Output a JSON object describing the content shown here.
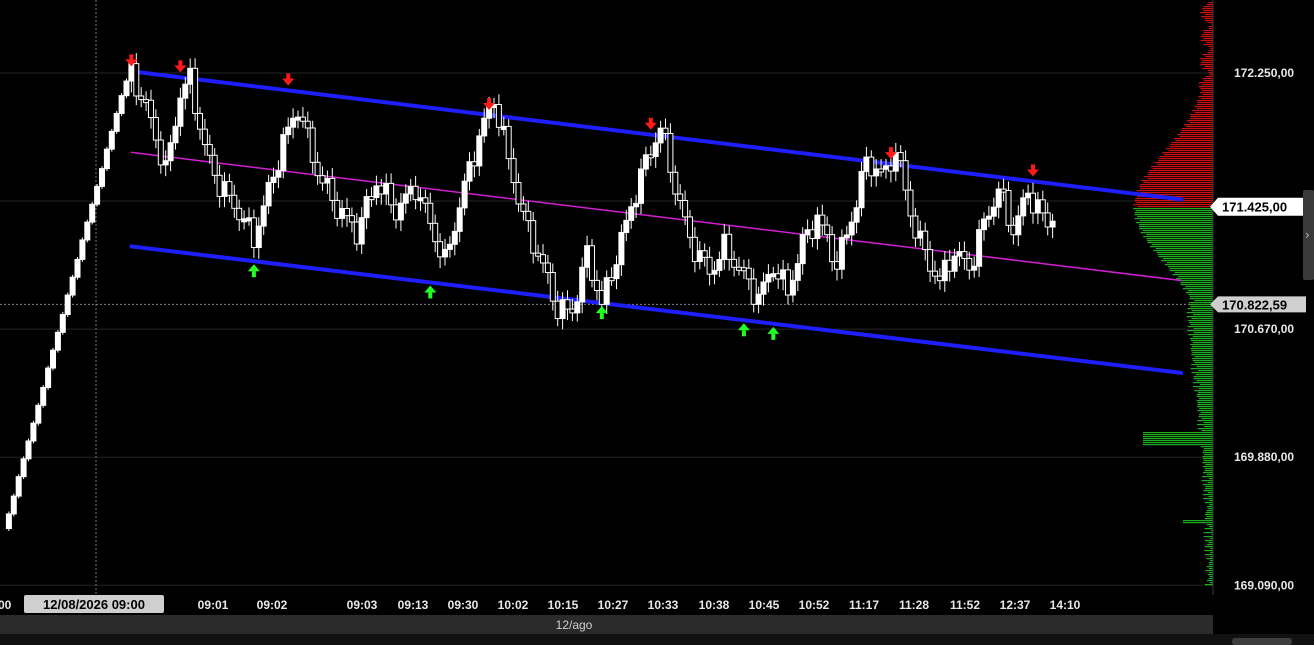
{
  "chart_data": {
    "type": "candlestick",
    "instrument_date": "12/08/2026 09:00",
    "session_label": "12/ago",
    "left_edge_label": "00",
    "x_tick_labels": [
      "09:01",
      "09:02",
      "09:03",
      "09:13",
      "09:30",
      "10:02",
      "10:15",
      "10:27",
      "10:33",
      "10:38",
      "10:45",
      "10:52",
      "11:17",
      "11:28",
      "11:52",
      "12:37",
      "14:10"
    ],
    "y_tick_labels": [
      {
        "label": "172.250,00",
        "value": 172250
      },
      {
        "label": "170.670,00",
        "value": 170670
      },
      {
        "label": "169.880,00",
        "value": 169880
      },
      {
        "label": "169.090,00",
        "value": 169090
      }
    ],
    "hidden_tick_value": 171460,
    "ylim": [
      169030,
      172700
    ],
    "last_price": {
      "label": "171.425,00",
      "value": 171425
    },
    "reference_price": {
      "label": "170.822,59",
      "value": 170822.59
    },
    "price_path": [
      [
        0,
        169440
      ],
      [
        0.5,
        169530
      ],
      [
        1,
        169640
      ],
      [
        1.5,
        169760
      ],
      [
        2,
        169870
      ],
      [
        2.5,
        169980
      ],
      [
        3,
        170090
      ],
      [
        3.5,
        170200
      ],
      [
        4,
        170310
      ],
      [
        4.5,
        170430
      ],
      [
        5,
        170540
      ],
      [
        5.5,
        170650
      ],
      [
        6,
        170760
      ],
      [
        6.5,
        170880
      ],
      [
        7,
        170990
      ],
      [
        7.5,
        171100
      ],
      [
        8,
        171220
      ],
      [
        8.5,
        171330
      ],
      [
        9,
        171440
      ],
      [
        9.5,
        171550
      ],
      [
        10,
        171660
      ],
      [
        10.5,
        171780
      ],
      [
        11,
        171890
      ],
      [
        11.5,
        172000
      ],
      [
        12,
        172110
      ],
      [
        12.5,
        172200
      ],
      [
        13,
        172250
      ],
      [
        15,
        171960
      ],
      [
        16.5,
        171640
      ],
      [
        18,
        172120
      ],
      [
        19,
        172210
      ],
      [
        20.5,
        171780
      ],
      [
        22,
        171560
      ],
      [
        24,
        171390
      ],
      [
        25.5,
        171230
      ],
      [
        27,
        171520
      ],
      [
        28.5,
        171820
      ],
      [
        30,
        172040
      ],
      [
        32,
        171640
      ],
      [
        34,
        171420
      ],
      [
        36,
        171270
      ],
      [
        38,
        171580
      ],
      [
        40,
        171400
      ],
      [
        42,
        171550
      ],
      [
        43.5,
        171320
      ],
      [
        45,
        171080
      ],
      [
        47,
        171550
      ],
      [
        48.5,
        171860
      ],
      [
        50,
        172090
      ],
      [
        51.5,
        171720
      ],
      [
        53,
        171360
      ],
      [
        55,
        171060
      ],
      [
        56.5,
        170790
      ],
      [
        58,
        170780
      ],
      [
        59.5,
        171130
      ],
      [
        61,
        170820
      ],
      [
        63,
        171220
      ],
      [
        65,
        171620
      ],
      [
        67,
        171920
      ],
      [
        68.5,
        171550
      ],
      [
        70,
        171220
      ],
      [
        72,
        171020
      ],
      [
        73.5,
        171170
      ],
      [
        75,
        171050
      ],
      [
        77,
        170860
      ],
      [
        78.5,
        171060
      ],
      [
        80,
        170900
      ],
      [
        81.5,
        171200
      ],
      [
        83,
        171360
      ],
      [
        85,
        171070
      ],
      [
        86.5,
        171350
      ],
      [
        88,
        171700
      ],
      [
        90,
        171620
      ],
      [
        91,
        171790
      ],
      [
        92.5,
        171380
      ],
      [
        94,
        171130
      ],
      [
        95.5,
        170960
      ],
      [
        97,
        171150
      ],
      [
        98.5,
        171040
      ],
      [
        100,
        171320
      ],
      [
        101.5,
        171530
      ],
      [
        103,
        171280
      ],
      [
        104.5,
        171510
      ],
      [
        105.5,
        171420
      ],
      [
        106.5,
        171300
      ],
      [
        107,
        171390
      ]
    ],
    "resistance_marks_x": [
      13,
      18,
      29,
      49.5,
      66,
      90.5,
      105
    ],
    "support_marks_x": [
      25.5,
      43.5,
      61,
      75.5,
      78.5
    ],
    "channel": {
      "upper": {
        "x0": 13,
        "y0": 172260,
        "x1": 120,
        "y1": 171470
      },
      "middle": {
        "x0": 13,
        "y0": 171760,
        "x1": 120,
        "y1": 170970
      },
      "lower": {
        "x0": 13,
        "y0": 171180,
        "x1": 120,
        "y1": 170400
      }
    },
    "volume_profile_note": "red above last price, green below",
    "colors": {
      "background": "#000000",
      "candle": "#ffffff",
      "channel_outer": "#1e1eff",
      "channel_mid": "#d21ed2",
      "resistance_arrow": "#ff1a1a",
      "support_arrow": "#22ff22",
      "profile_up": "#cc1010",
      "profile_down": "#1fae1f",
      "grid": "#262626"
    }
  }
}
